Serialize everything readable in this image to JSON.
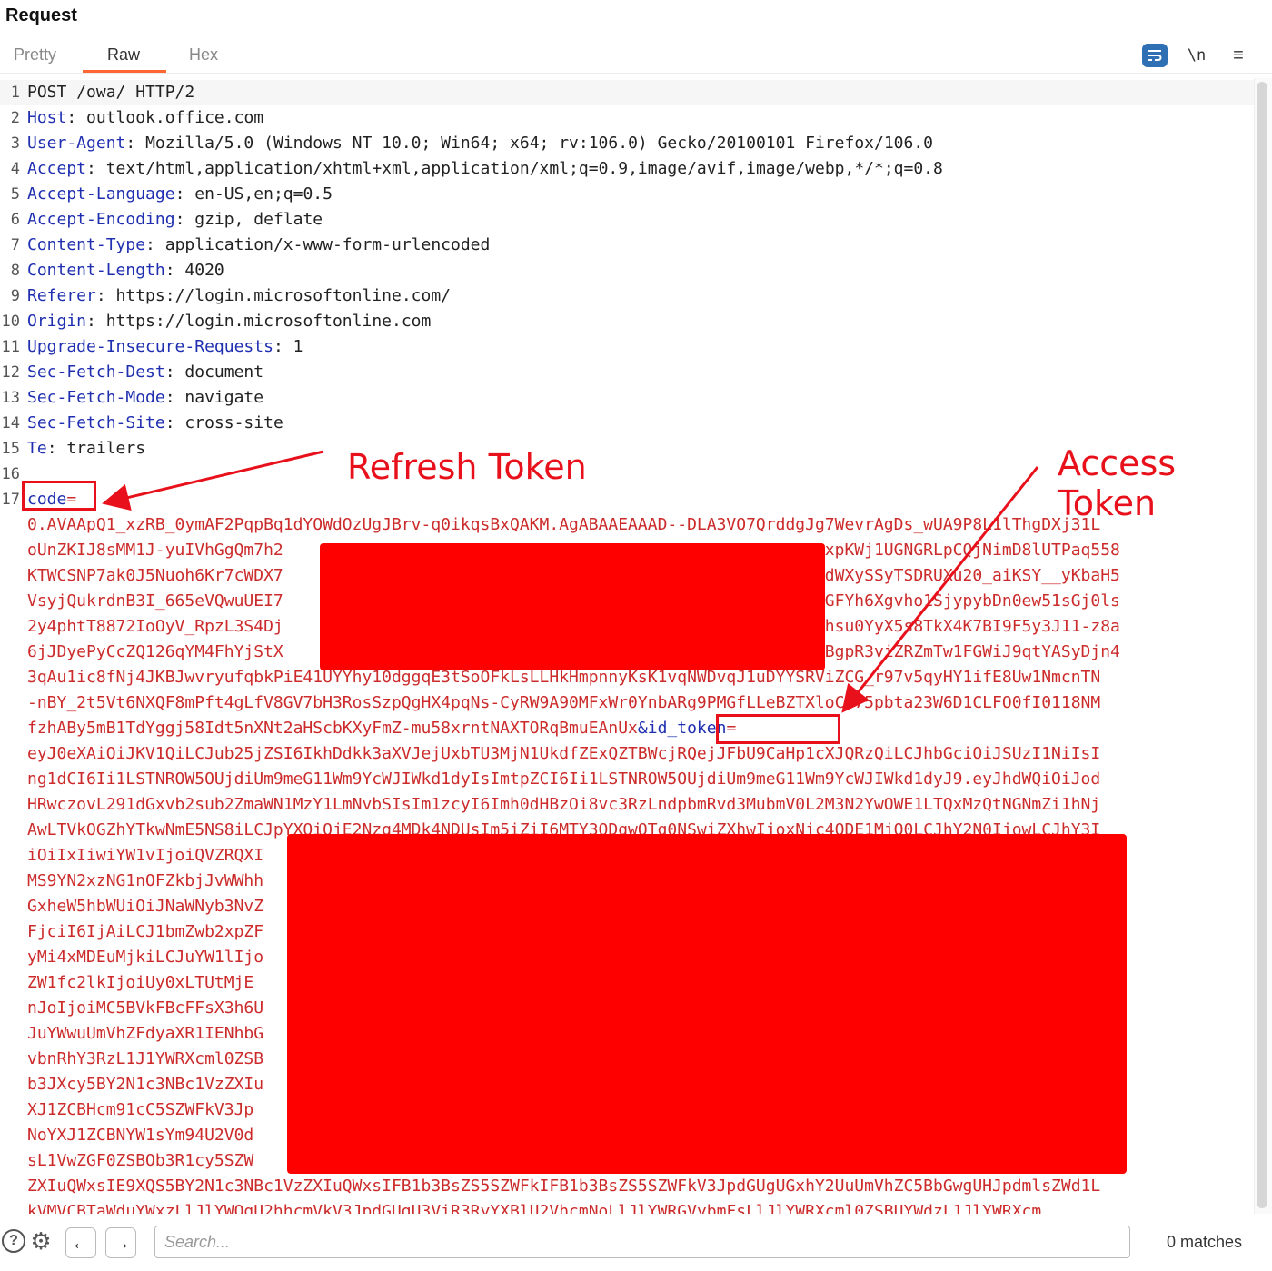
{
  "panel": {
    "title": "Request"
  },
  "tabs": [
    {
      "label": "Pretty",
      "active": false
    },
    {
      "label": "Raw",
      "active": true
    },
    {
      "label": "Hex",
      "active": false
    }
  ],
  "toolbar": {
    "wrap_icon": "wrap-lines-icon",
    "newline_label": "\\n",
    "menu_icon": "hamburger-menu-icon"
  },
  "request": {
    "request_line": "POST /owa/ HTTP/2",
    "headers": [
      {
        "name": "Host",
        "value": "outlook.office.com"
      },
      {
        "name": "User-Agent",
        "value": "Mozilla/5.0 (Windows NT 10.0; Win64; x64; rv:106.0) Gecko/20100101 Firefox/106.0"
      },
      {
        "name": "Accept",
        "value": "text/html,application/xhtml+xml,application/xml;q=0.9,image/avif,image/webp,*/*;q=0.8"
      },
      {
        "name": "Accept-Language",
        "value": "en-US,en;q=0.5"
      },
      {
        "name": "Accept-Encoding",
        "value": "gzip, deflate"
      },
      {
        "name": "Content-Type",
        "value": "application/x-www-form-urlencoded"
      },
      {
        "name": "Content-Length",
        "value": "4020"
      },
      {
        "name": "Referer",
        "value": "https://login.microsoftonline.com/"
      },
      {
        "name": "Origin",
        "value": "https://login.microsoftonline.com"
      },
      {
        "name": "Upgrade-Insecure-Requests",
        "value": "1"
      },
      {
        "name": "Sec-Fetch-Dest",
        "value": "document"
      },
      {
        "name": "Sec-Fetch-Mode",
        "value": "navigate"
      },
      {
        "name": "Sec-Fetch-Site",
        "value": "cross-site"
      },
      {
        "name": "Te",
        "value": "trailers"
      }
    ],
    "body_param_code": "code",
    "body_param_id_token": "&id_token",
    "body_lines": [
      "0.AVAApQ1_xzRB_0ymAF2PqpBq1dYOWdOzUgJBrv-q0ikqsBxQAKM.AgABAAEAAAD--DLA3VO7QrddgJg7WevrAgDs_wUA9P8L1lThgDXj31L",
      "oUnZKIJ8sMM1J-yuIVhGgQm7h2                                               SKu3-YuGxpKWj1UGNGRLpCQjNimD8lUTPaq558",
      "KTWCSNP7ak0J5Nuoh6Kr7cWDX7                                               XB41wVsEdWXySSyTSDRUXu20_aiKSY__yKbaH5",
      "VsyjQukrdnB3I_665eVQwuUEI7                                               N3NwM5aiGFYh6Xgvho1SjypybDn0ew51sGj0ls",
      "2y4phtT8872IoOyV_RpzL3S4Dj                                               zE12NK-bhsu0YyX5s8TkX4K7BI9F5y3J11-z8a",
      "6jJDyePyCcZQ126qYM4FhYjStX                                               YJdPFm6KBgpR3viZRZmTw1FGWiJ9qtYASyDjn4",
      "3qAu1ic8fNj4JKBJwvryufqbkPiE41UYYhy10dggqE3tSoOFkLsLLHkHmpnnyKsK1vqNWDvqJ1uDYYSRViZCG_r97v5qyHY1ifE8Uw1NmcnTN",
      "-nBY_2t5Vt6NXQF8mPft4gLfV8GV7bH3RosSzpQgHX4pqNs-CyRW9A90MFxWr0YnbARg9PMGfLLeBZTXloCr75pbta23W6D1CLFO0fI0118NM",
      "fzhABy5mB1TdYggj58Idt5nXNt2aHScbKXyFmZ-mu58xrntNAXTORqBmuEAnUx",
      "eyJ0eXAiOiJKV1QiLCJub25jZSI6IkhDdkk3aXVJejUxbTU3MjN1UkdfZExQZTBWcjRQejJFbU9CaHp1cXJQRzQiLCJhbGciOiJSUzI1NiIsI",
      "ng1dCI6Ii1LSTNROW5OUjdiUm9meG11Wm9YcWJIWkd1dyIsImtpZCI6Ii1LSTNROW5OUjdiUm9meG11Wm9YcWJIWkd1dyJ9.eyJhdWQiOiJod",
      "HRwczovL291dGxvb2sub2ZmaWN1MzY1LmNvbSIsIm1zcyI6Imh0dHBzOi8vc3RzLndpbmRvd3MubmV0L2M3N2YwOWE1LTQxMzQtNGNmZi1hNj",
      "AwLTVkOGZhYTkwNmE5NS8iLCJpYXQiOjE2Nzg4MDk4NDUsIm5iZiI6MTY3ODgwOTg0NSwiZXhwIjoxNjc4ODE1MjQ0LCJhY2N0IjowLCJhY3I",
      "iOiIxIiwiYW1vIjoiQVZRQXI                                                                        TYwc1ZPd2sw",
      "MS9YN2xzNG1nOFZkbjJvWWhh                                                                        JhcHBfZGlzc",
      "GxheW5hbWUiOiJNaWNyb3NvZ                                                                        iLCJhcHBpZG",
      "FjciI6IjAiLCJ1bmZwb2xpZF                                                                        IjoiMjA5LjE",
      "yMi4xMDEuMjkiLCJuYW1lIjo                                                                        TAiLCJvbnBy",
      "ZW1fc2lkIjoiUy0xLTUtMjE                                                                         Y2OEQ2NSIsI",
      "nJoIjoiMC5BVkFBcFFsX3h6U                                                                        vcmQtSW50ZX",
      "JuYWwuUmVhZFdyaXR1IENhbG                                                                        ZFdyaXR1IEN",
      "vbnRhY3RzL1J1YWRXcml0ZSB                                                                        WxsIEVvcFBz",
      "b3JXcy5BY2N1c3NBc1VzZXIu                                                                        dyaXR1L1NoY",
      "XJ1ZCBHcm91cC5SZWFkV3Jp                                                                         bC5TZW5kL1",
      "NoYXJ1ZCBNYW1sYm94U2V0d                                                                         LUludGVybmF",
      "sL1VwZGF0ZSBOb3R1cy5SZW                                                                         2N1c3NBc1Vz",
      "ZXIuQWxsIE9XQS5BY2N1c3NBc1VzZXIuQWxsIFB1b3BsZS5SZWFkIFB1b3BsZS5SZWFkV3JpdGUgUGxhY2UuUmVhZC5BbGwgUHJpdmlsZWd1L",
      "kVMVCBTaWduYWxzLlJlYWQgU2hhcmVkV3JpdGUgU3ViR3RyYXBlU2VhcmNoLlJlYWRGVybmFsLlJlYWRXcml0ZSBUYWdzL1JlYWRXcm"
    ]
  },
  "annotations": {
    "refresh_label": "Refresh Token",
    "access_label": "Access Token"
  },
  "footer": {
    "help_icon": "help-icon",
    "settings_icon": "settings-icon",
    "back_icon": "arrow-left-icon",
    "forward_icon": "arrow-right-icon",
    "search_placeholder": "Search...",
    "matches_label": "0 matches"
  }
}
